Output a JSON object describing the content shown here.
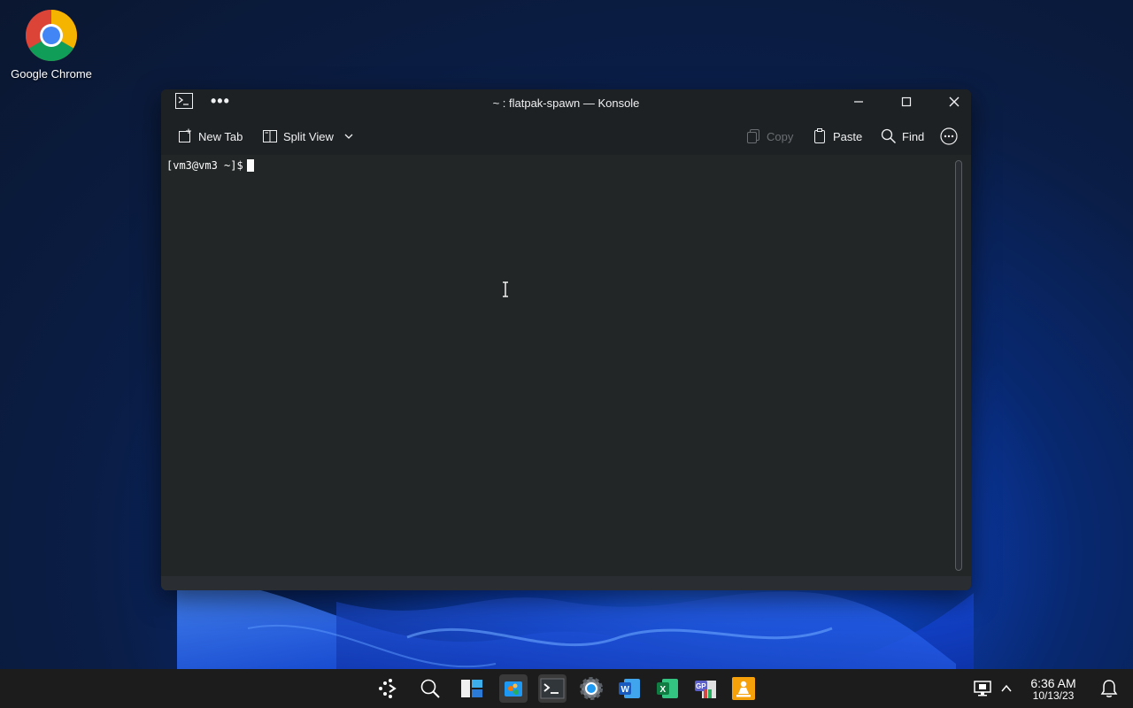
{
  "desktop": {
    "icons": [
      {
        "label": "Google Chrome",
        "icon": "chrome-icon"
      }
    ]
  },
  "window": {
    "title": "~ : flatpak-spawn — Konsole",
    "app_icon": "terminal-icon"
  },
  "toolbar": {
    "new_tab": "New Tab",
    "split_view": "Split View",
    "copy": "Copy",
    "paste": "Paste",
    "find": "Find"
  },
  "terminal": {
    "prompt": "[vm3@vm3 ~]$"
  },
  "taskbar": {
    "apps": [
      "start-icon",
      "search-icon",
      "widgets-icon",
      "store-icon",
      "terminal-icon",
      "settings-icon",
      "word-icon",
      "excel-icon",
      "gimp-icon",
      "vlc-icon"
    ],
    "time": "6:36 AM",
    "date": "10/13/23"
  },
  "colors": {
    "window_bg": "#232629",
    "terminal_bg": "#232627",
    "taskbar_bg": "#1c1c1c",
    "accent": "#3daee9"
  }
}
